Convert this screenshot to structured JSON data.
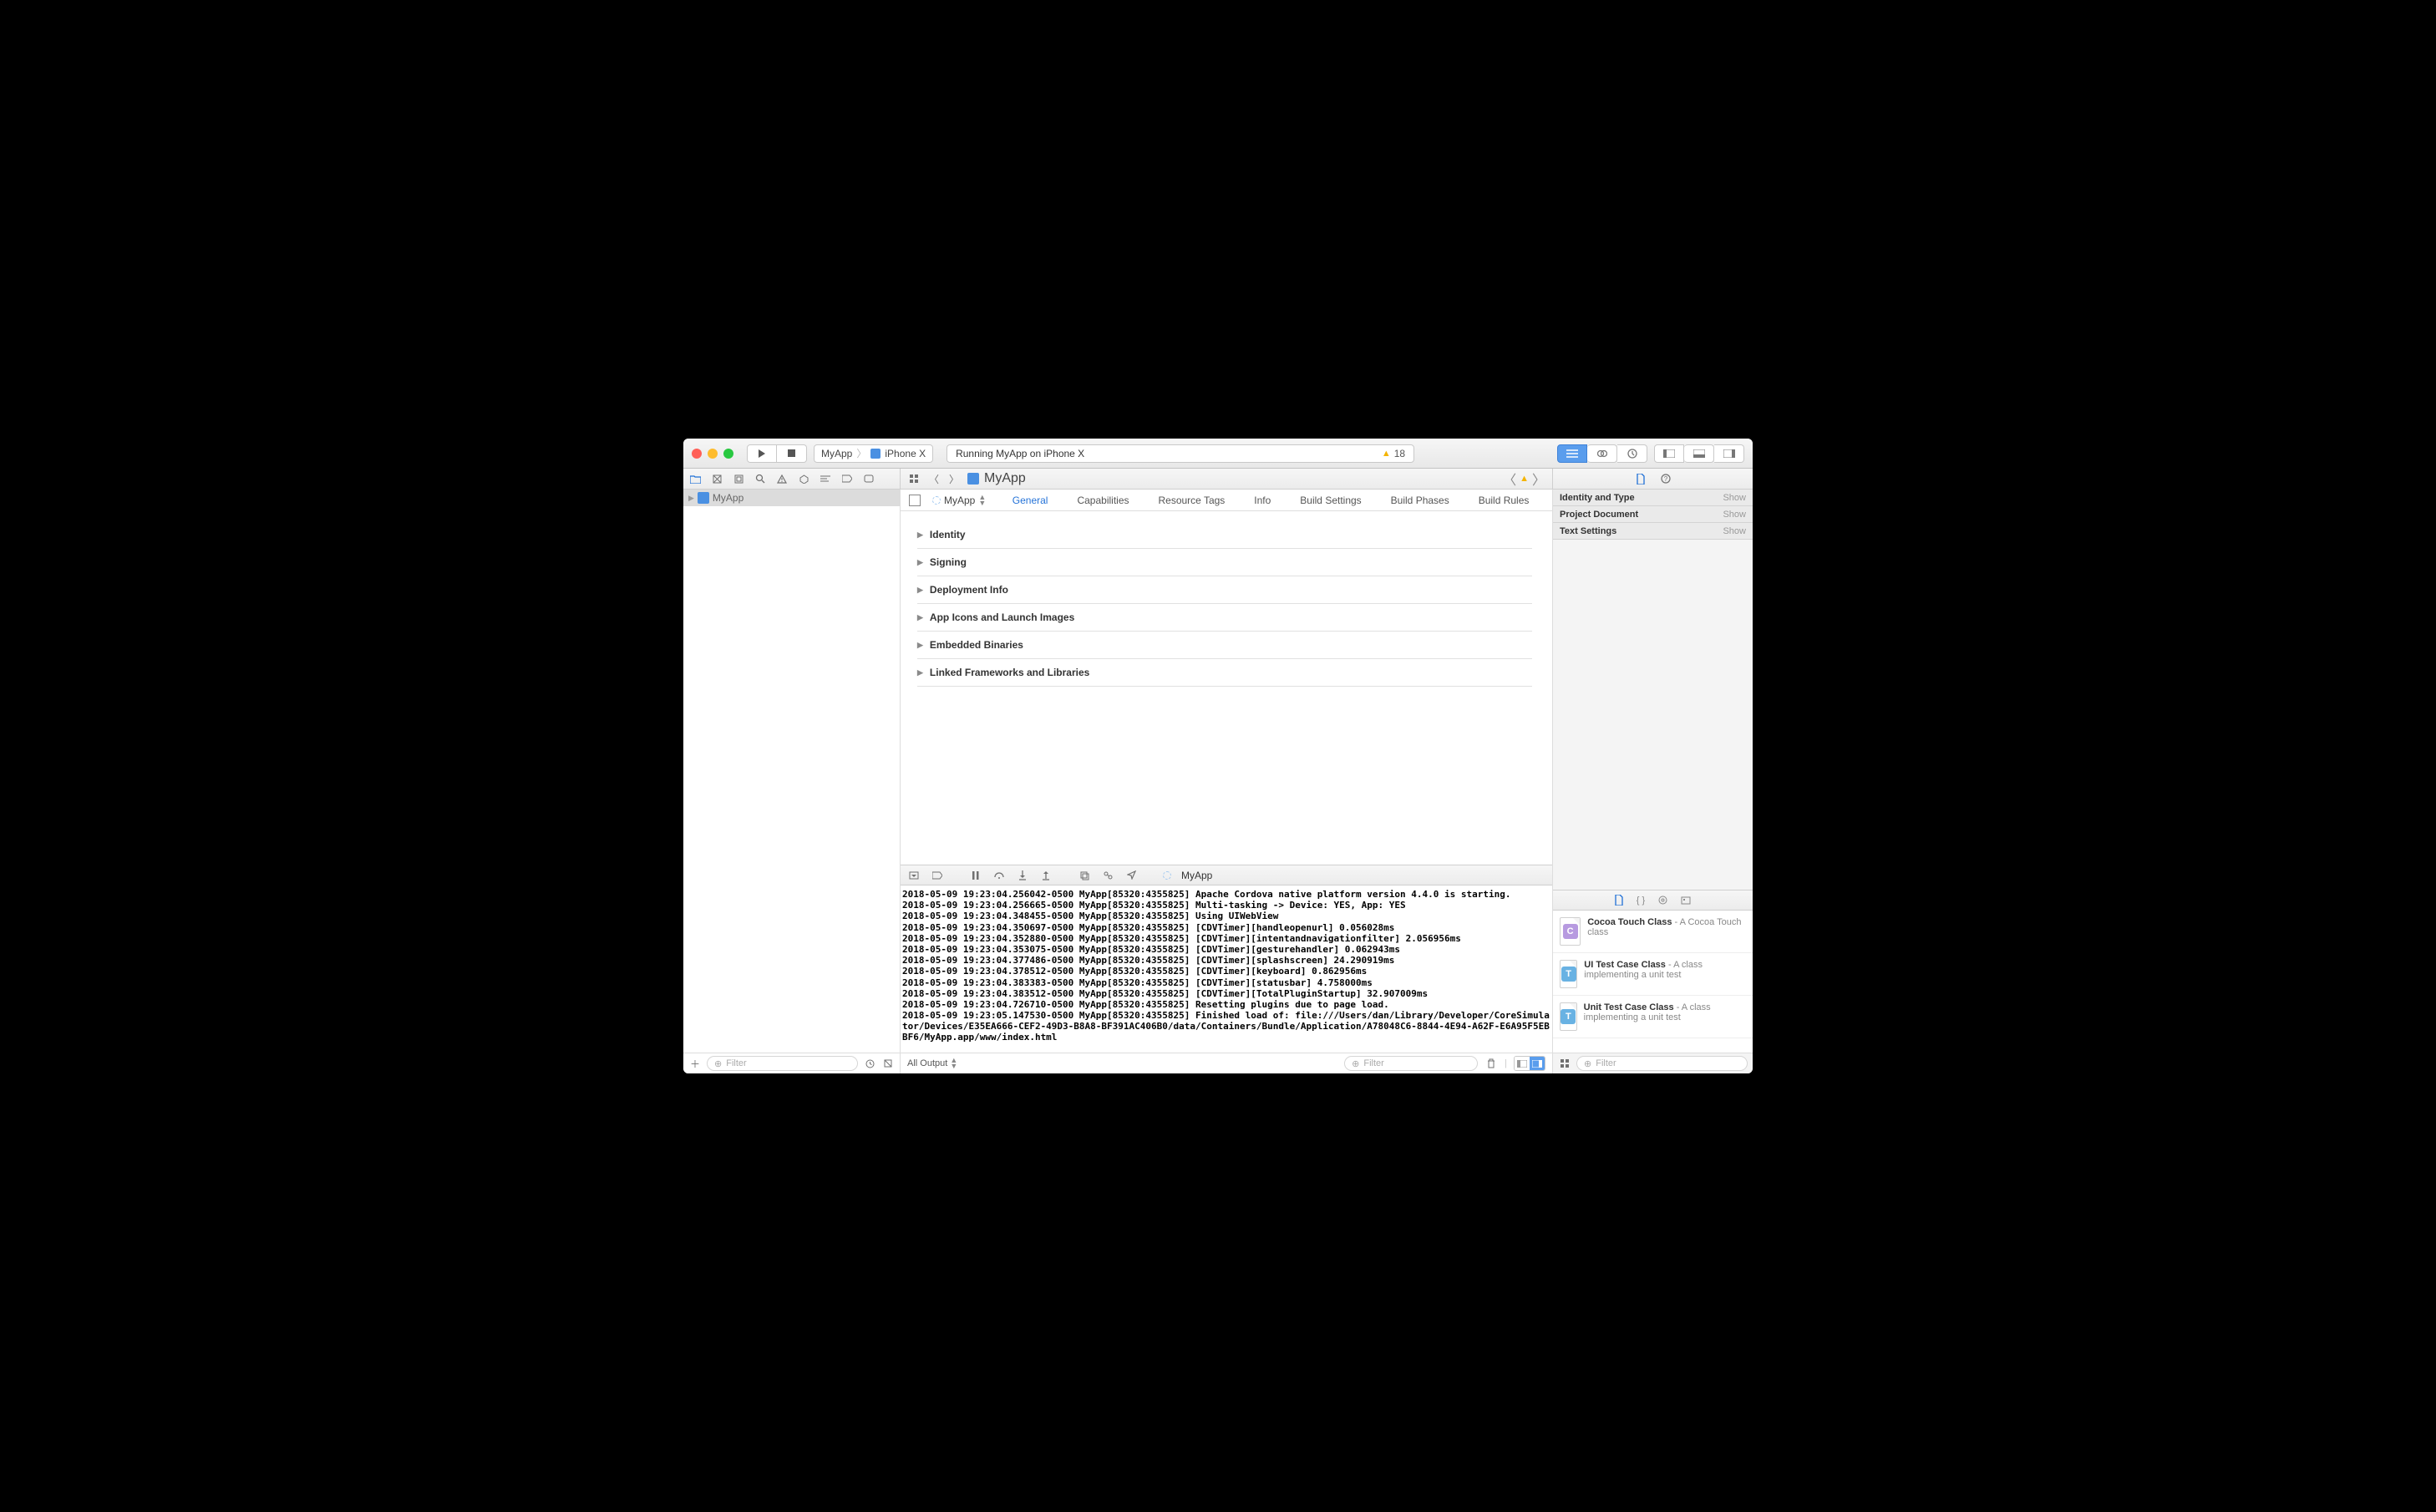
{
  "scheme": {
    "project": "MyApp",
    "device": "iPhone X"
  },
  "status": {
    "text": "Running MyApp on iPhone X",
    "warning_count": "18"
  },
  "navigator": {
    "project_name": "MyApp",
    "filter_placeholder": "Filter"
  },
  "jumpbar": {
    "item": "MyApp"
  },
  "target_selector": "MyApp",
  "editor_tabs": [
    "General",
    "Capabilities",
    "Resource Tags",
    "Info",
    "Build Settings",
    "Build Phases",
    "Build Rules"
  ],
  "active_editor_tab": 0,
  "sections": [
    "Identity",
    "Signing",
    "Deployment Info",
    "App Icons and Launch Images",
    "Embedded Binaries",
    "Linked Frameworks and Libraries"
  ],
  "debug_process": "MyApp",
  "console_lines": [
    "2018-05-09 19:23:04.256042-0500 MyApp[85320:4355825] Apache Cordova native platform version 4.4.0 is starting.",
    "2018-05-09 19:23:04.256665-0500 MyApp[85320:4355825] Multi-tasking -> Device: YES, App: YES",
    "2018-05-09 19:23:04.348455-0500 MyApp[85320:4355825] Using UIWebView",
    "2018-05-09 19:23:04.350697-0500 MyApp[85320:4355825] [CDVTimer][handleopenurl] 0.056028ms",
    "2018-05-09 19:23:04.352880-0500 MyApp[85320:4355825] [CDVTimer][intentandnavigationfilter] 2.056956ms",
    "2018-05-09 19:23:04.353075-0500 MyApp[85320:4355825] [CDVTimer][gesturehandler] 0.062943ms",
    "2018-05-09 19:23:04.377486-0500 MyApp[85320:4355825] [CDVTimer][splashscreen] 24.290919ms",
    "2018-05-09 19:23:04.378512-0500 MyApp[85320:4355825] [CDVTimer][keyboard] 0.862956ms",
    "2018-05-09 19:23:04.383383-0500 MyApp[85320:4355825] [CDVTimer][statusbar] 4.758000ms",
    "2018-05-09 19:23:04.383512-0500 MyApp[85320:4355825] [CDVTimer][TotalPluginStartup] 32.907009ms",
    "2018-05-09 19:23:04.726710-0500 MyApp[85320:4355825] Resetting plugins due to page load.",
    "2018-05-09 19:23:05.147530-0500 MyApp[85320:4355825] Finished load of: file:///Users/dan/Library/Developer/CoreSimulator/Devices/E35EA666-CEF2-49D3-B8A8-BF391AC406B0/data/Containers/Bundle/Application/A78048C6-8844-4E94-A62F-E6A95F5EBBF6/MyApp.app/www/index.html"
  ],
  "console_filter": {
    "scope": "All Output",
    "placeholder": "Filter"
  },
  "inspector": {
    "sections": [
      {
        "title": "Identity and Type",
        "action": "Show"
      },
      {
        "title": "Project Document",
        "action": "Show"
      },
      {
        "title": "Text Settings",
        "action": "Show"
      }
    ]
  },
  "library": {
    "items": [
      {
        "badge": "C",
        "color": "#b79ae0",
        "title": "Cocoa Touch Class",
        "desc": " - A Cocoa Touch class"
      },
      {
        "badge": "T",
        "color": "#69b2e3",
        "title": "UI Test Case Class",
        "desc": " - A class implementing a unit test"
      },
      {
        "badge": "T",
        "color": "#69b2e3",
        "title": "Unit Test Case Class",
        "desc": " - A class implementing a unit test"
      }
    ],
    "filter_placeholder": "Filter"
  }
}
